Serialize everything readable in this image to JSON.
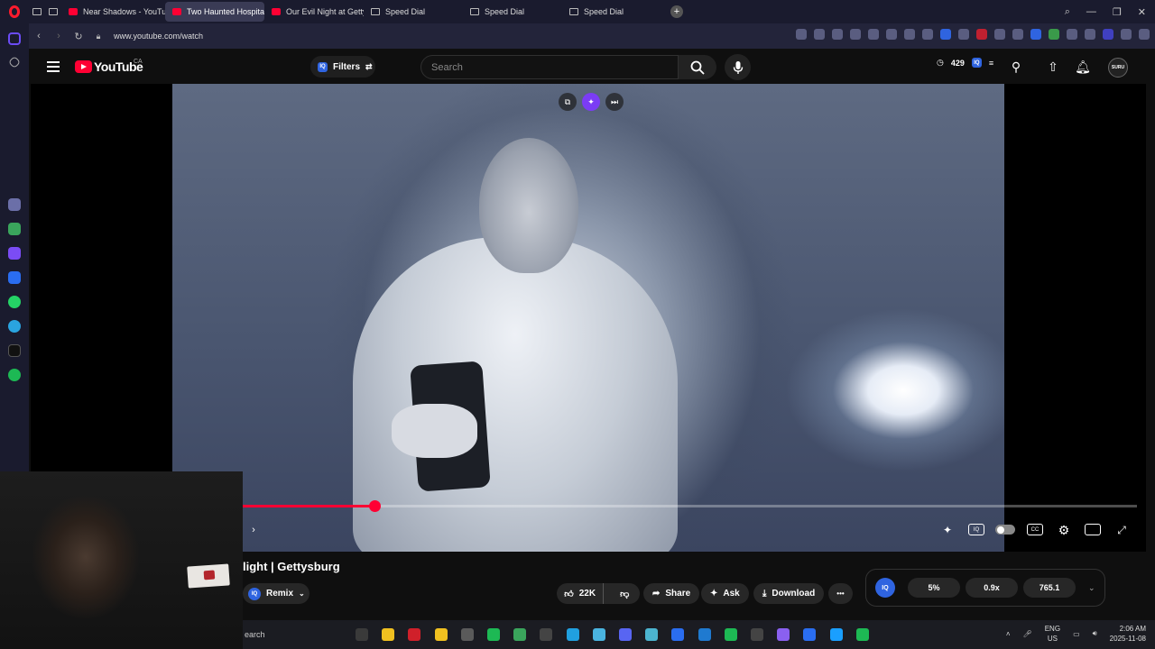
{
  "browser": {
    "tabs": [
      {
        "label": "Near Shadows - YouTube",
        "type": "yt",
        "active": false
      },
      {
        "label": "Two Haunted Hospita",
        "type": "yt",
        "active": true
      },
      {
        "label": "Our Evil Night at Gettysbu",
        "type": "yt",
        "active": false
      },
      {
        "label": "Speed Dial",
        "type": "sd",
        "active": false
      },
      {
        "label": "Speed Dial",
        "type": "sd",
        "active": false
      },
      {
        "label": "Speed Dial",
        "type": "sd",
        "active": false
      }
    ],
    "url": "www.youtube.com/watch",
    "new_tab_symbol": "+",
    "window_controls": {
      "search": "⌕",
      "minimize": "—",
      "restore": "❐",
      "close": "✕"
    }
  },
  "youtube": {
    "brand": "YouTube",
    "region": "CA",
    "filters_label": "Filters",
    "search_placeholder": "Search",
    "watch_count": "429",
    "avatar_text": "SURU"
  },
  "video": {
    "progress_fraction": 0.147,
    "title": "light | Gettysburg",
    "remix_label": "Remix",
    "likes": "22K",
    "share_label": "Share",
    "ask_label": "Ask",
    "download_label": "Download",
    "more_label": "•••",
    "cc_label": "CC"
  },
  "iq_panel": {
    "badge": "IQ",
    "stat1": "5%",
    "stat2": "0.9x",
    "stat3": "765.1"
  },
  "taskbar": {
    "search_text": "earch",
    "language": "ENG",
    "region": "US",
    "time": "2:06 AM",
    "date": "2025-11-08"
  },
  "colors": {
    "yt_red": "#ff0033",
    "iq_blue": "#2f64e0",
    "ai_purple": "#7b3cf5",
    "background": "#0f0f0f"
  }
}
